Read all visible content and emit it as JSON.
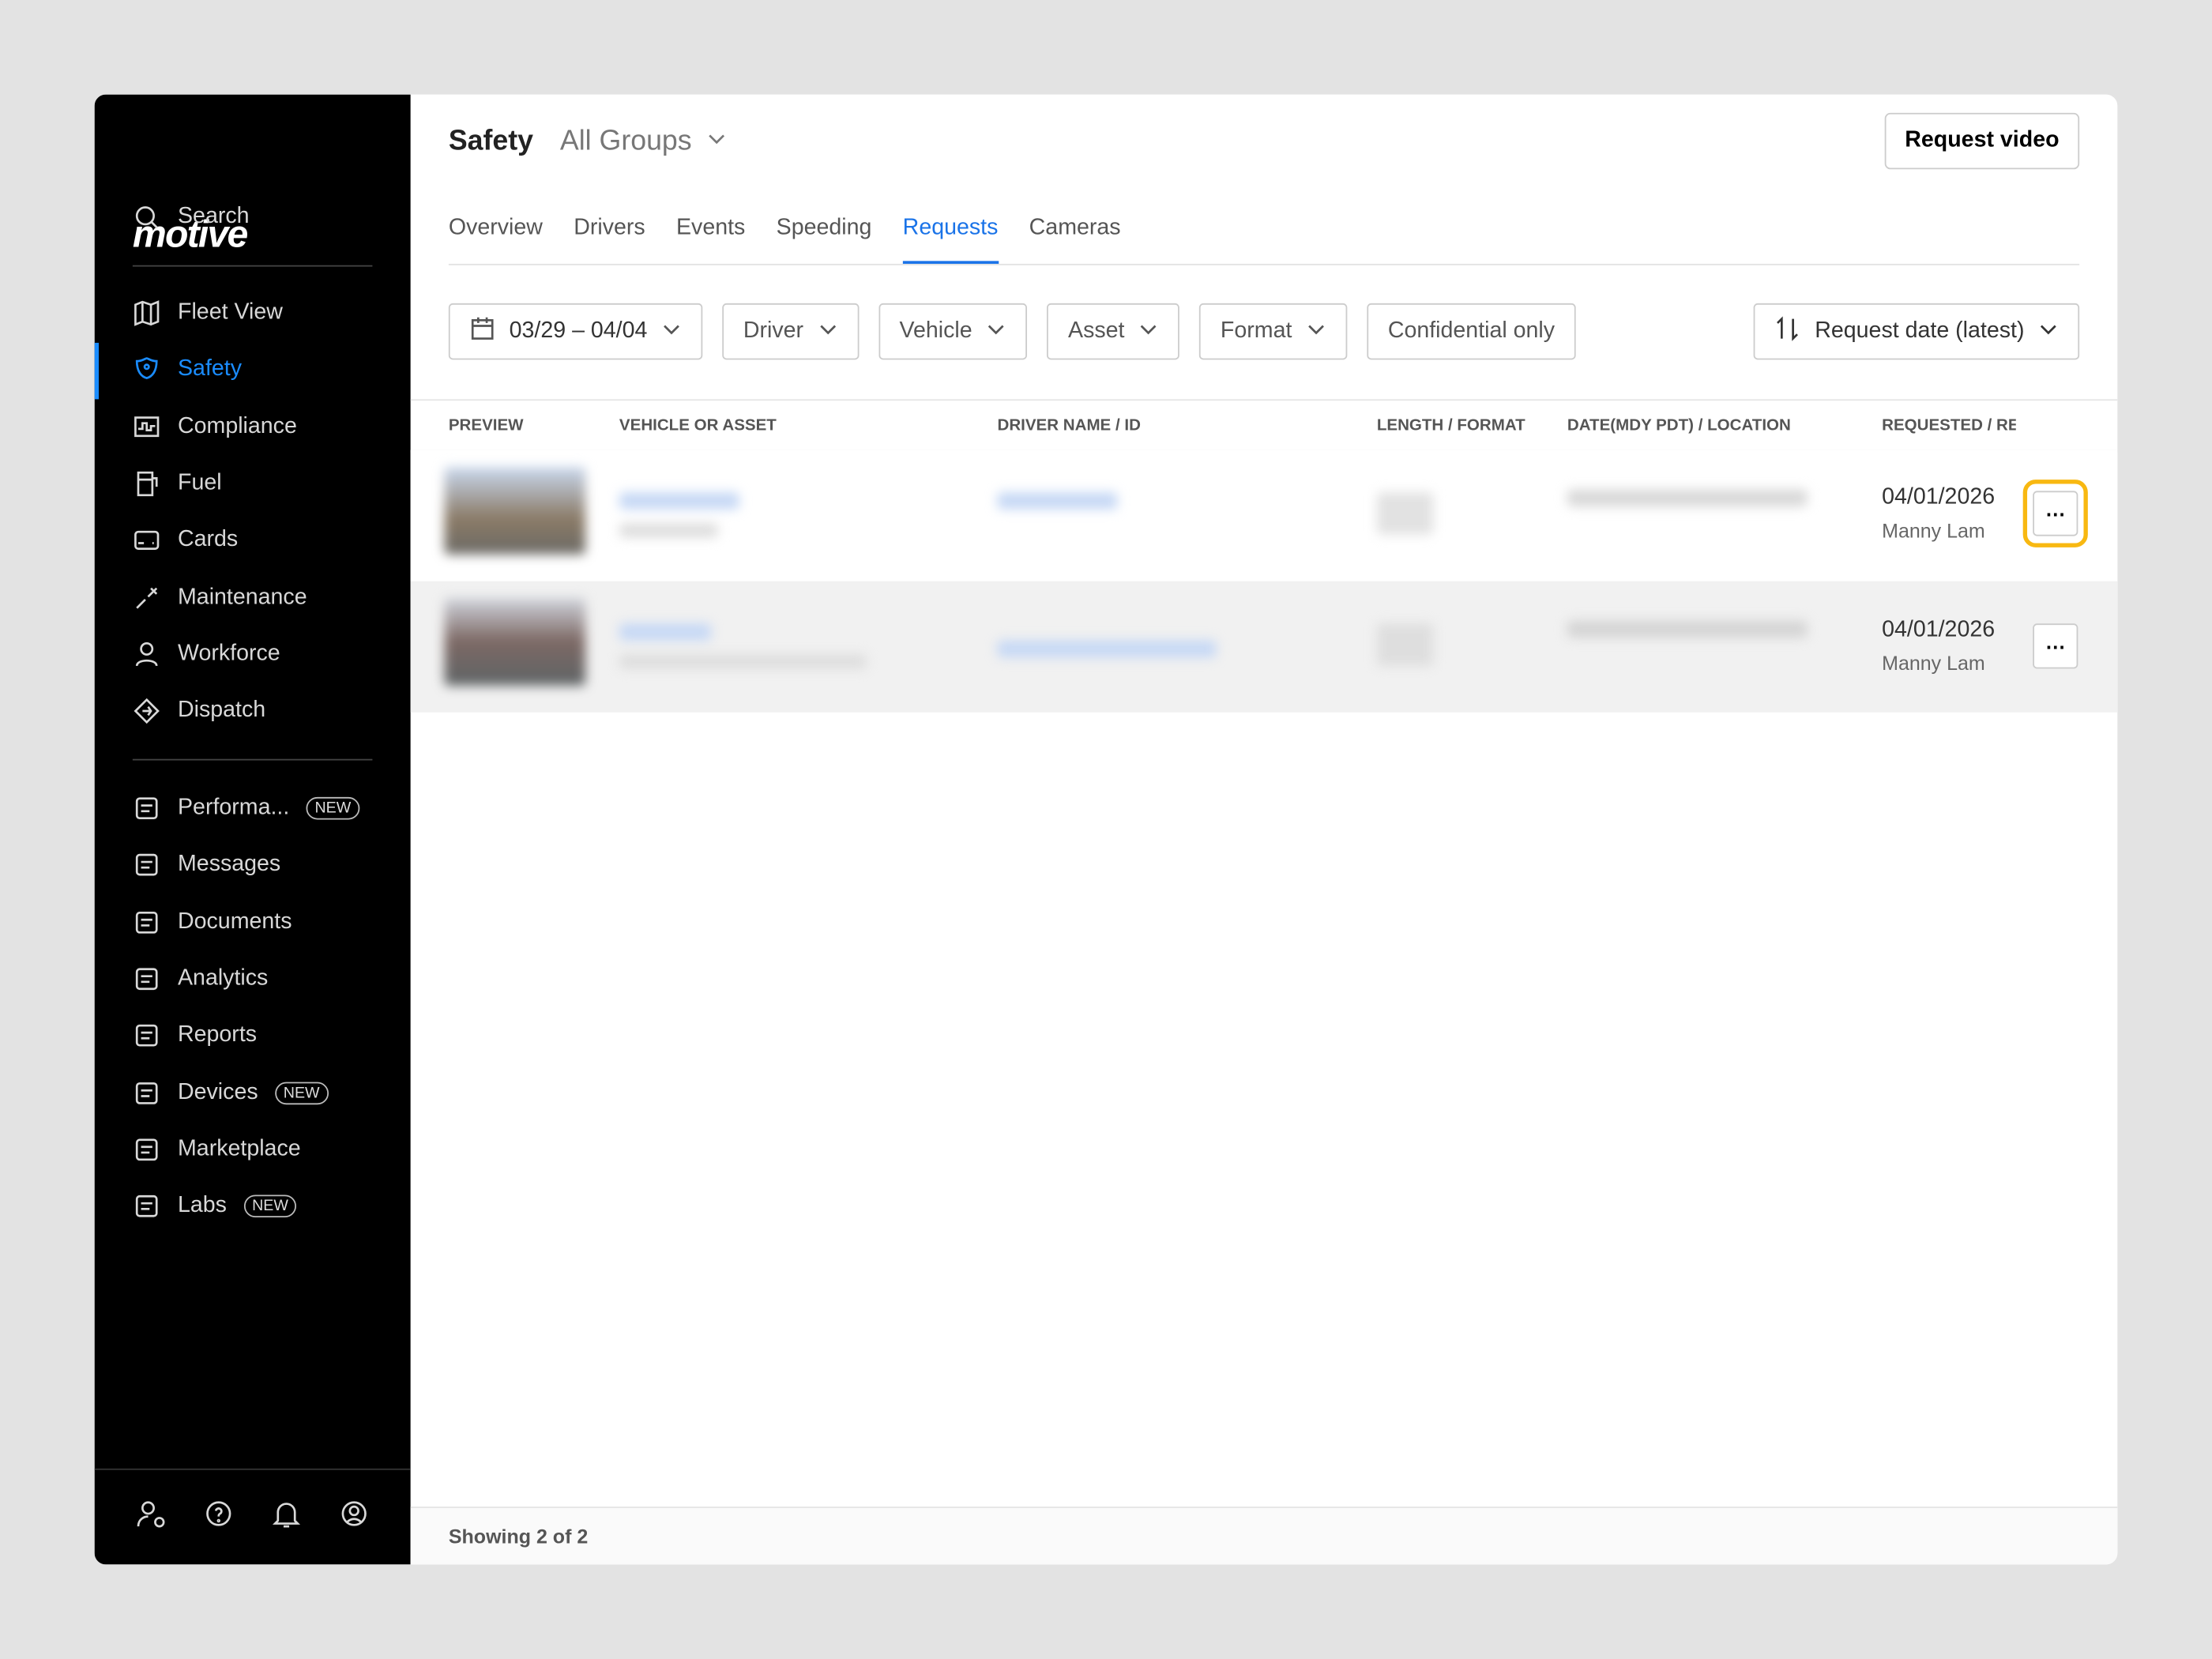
{
  "brand": "motive",
  "sidebar": {
    "search": "Search",
    "items": [
      {
        "label": "Fleet View",
        "icon": "map-icon"
      },
      {
        "label": "Safety",
        "icon": "shield-icon",
        "active": true
      },
      {
        "label": "Compliance",
        "icon": "compliance-icon"
      },
      {
        "label": "Fuel",
        "icon": "fuel-icon"
      },
      {
        "label": "Cards",
        "icon": "card-icon"
      },
      {
        "label": "Maintenance",
        "icon": "wrench-icon"
      },
      {
        "label": "Workforce",
        "icon": "user-icon"
      },
      {
        "label": "Dispatch",
        "icon": "dispatch-icon"
      }
    ],
    "items2": [
      {
        "label": "Performa...",
        "badge": "NEW"
      },
      {
        "label": "Messages"
      },
      {
        "label": "Documents"
      },
      {
        "label": "Analytics"
      },
      {
        "label": "Reports"
      },
      {
        "label": "Devices",
        "badge": "NEW"
      },
      {
        "label": "Marketplace"
      },
      {
        "label": "Labs",
        "badge": "NEW"
      }
    ]
  },
  "header": {
    "title": "Safety",
    "group": "All Groups",
    "request_video": "Request video"
  },
  "tabs": [
    "Overview",
    "Drivers",
    "Events",
    "Speeding",
    "Requests",
    "Cameras"
  ],
  "active_tab": "Requests",
  "filters": {
    "date": "03/29 – 04/04",
    "driver": "Driver",
    "vehicle": "Vehicle",
    "asset": "Asset",
    "format": "Format",
    "confidential": "Confidential only",
    "sort": "Request date (latest)"
  },
  "table": {
    "columns": [
      "PREVIEW",
      "VEHICLE OR ASSET",
      "DRIVER NAME / ID",
      "LENGTH / FORMAT",
      "DATE(MDY PDT) / LOCATION",
      "REQUESTED / RE"
    ],
    "rows": [
      {
        "requested_date": "04/01/2026",
        "requested_by": "Manny Lam"
      },
      {
        "requested_date": "04/01/2026",
        "requested_by": "Manny Lam"
      }
    ]
  },
  "footer": "Showing 2 of 2",
  "colors": {
    "accent": "#1a73e8",
    "sidebar_active": "#1a8cff",
    "highlight": "#f8b811"
  }
}
